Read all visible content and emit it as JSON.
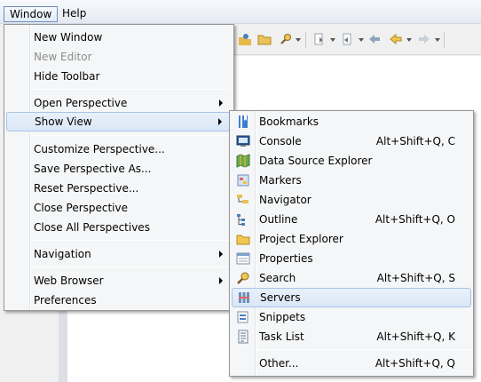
{
  "menubar": {
    "window_label": "Window",
    "help_label": "Help"
  },
  "window_menu": {
    "new_window": "New Window",
    "new_editor": "New Editor",
    "hide_toolbar": "Hide Toolbar",
    "open_perspective": "Open Perspective",
    "show_view": "Show View",
    "customize_perspective": "Customize Perspective...",
    "save_perspective_as": "Save Perspective As...",
    "reset_perspective": "Reset Perspective...",
    "close_perspective": "Close Perspective",
    "close_all_perspectives": "Close All Perspectives",
    "navigation": "Navigation",
    "web_browser": "Web Browser",
    "preferences": "Preferences"
  },
  "show_view_menu": {
    "bookmarks": {
      "label": "Bookmarks",
      "icon": "bookmarks-icon"
    },
    "console": {
      "label": "Console",
      "shortcut": "Alt+Shift+Q, C",
      "icon": "console-icon"
    },
    "data_source_explorer": {
      "label": "Data Source Explorer",
      "icon": "data-source-icon"
    },
    "markers": {
      "label": "Markers",
      "icon": "markers-icon"
    },
    "navigator": {
      "label": "Navigator",
      "icon": "navigator-icon"
    },
    "outline": {
      "label": "Outline",
      "shortcut": "Alt+Shift+Q, O",
      "icon": "outline-icon"
    },
    "project_explorer": {
      "label": "Project Explorer",
      "icon": "folder-icon"
    },
    "properties": {
      "label": "Properties",
      "icon": "properties-icon"
    },
    "search": {
      "label": "Search",
      "shortcut": "Alt+Shift+Q, S",
      "icon": "search-icon"
    },
    "servers": {
      "label": "Servers",
      "icon": "servers-icon"
    },
    "snippets": {
      "label": "Snippets",
      "icon": "snippets-icon"
    },
    "task_list": {
      "label": "Task List",
      "shortcut": "Alt+Shift+Q, K",
      "icon": "task-list-icon"
    },
    "other": {
      "label": "Other...",
      "shortcut": "Alt+Shift+Q, Q"
    }
  },
  "colors": {
    "highlight": "#dbe7f6",
    "highlight_border": "#a9c3e6",
    "menu_bg": "#f5f6f7"
  }
}
